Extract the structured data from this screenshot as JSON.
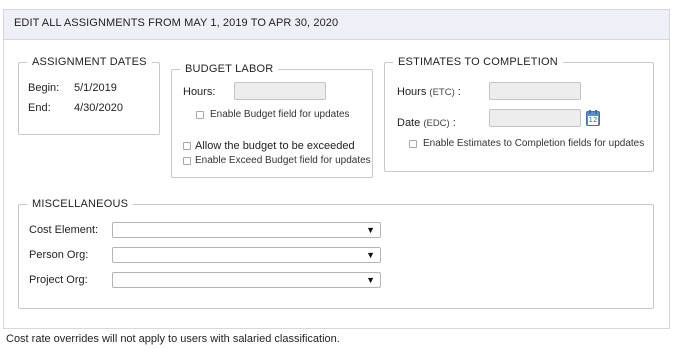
{
  "header": {
    "title": "EDIT ALL ASSIGNMENTS FROM MAY 1, 2019 TO APR 30, 2020"
  },
  "assignment_dates": {
    "legend": "ASSIGNMENT DATES",
    "begin_label": "Begin:",
    "begin_value": "5/1/2019",
    "end_label": "End:",
    "end_value": "4/30/2020"
  },
  "budget_labor": {
    "legend": "BUDGET LABOR",
    "hours_label": "Hours:",
    "hours_value": "",
    "enable_budget_label": "Enable Budget field for updates",
    "allow_exceed_label": "Allow the budget to be exceeded",
    "enable_exceed_label": "Enable Exceed Budget field for updates"
  },
  "estimates": {
    "legend": "ESTIMATES TO COMPLETION",
    "hours_label": "Hours",
    "hours_sub": "(ETC)",
    "hours_colon": ":",
    "hours_value": "",
    "date_label": "Date",
    "date_sub": "(EDC)",
    "date_colon": " :",
    "date_value": "",
    "calendar_number": "12",
    "enable_label": "Enable Estimates to Completion fields for updates"
  },
  "misc": {
    "legend": "MISCELLANEOUS",
    "cost_element_label": "Cost Element:",
    "cost_element_value": "",
    "person_org_label": "Person Org:",
    "person_org_value": "",
    "project_org_label": "Project Org:",
    "project_org_value": "",
    "dropdown_arrow": "▼"
  },
  "footnote": "Cost rate overrides will not apply to users with salaried classification."
}
